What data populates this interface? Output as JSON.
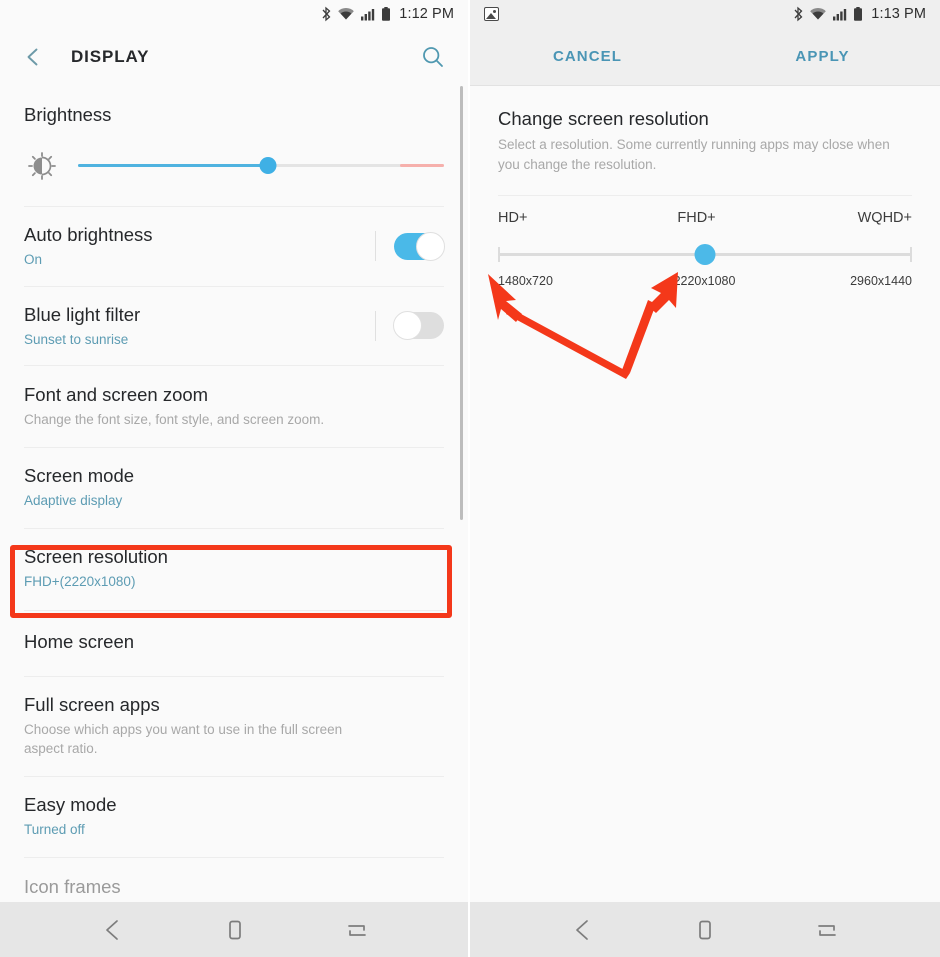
{
  "left_panel": {
    "statusbar": {
      "time": "1:12 PM",
      "icons": [
        "bluetooth-icon",
        "wifi-icon",
        "signal-icon",
        "battery-icon"
      ]
    },
    "appbar": {
      "back_icon": "back-chevron-icon",
      "title": "DISPLAY",
      "search_icon": "search-icon"
    },
    "brightness": {
      "label": "Brightness",
      "icon": "brightness-sun-icon",
      "value_percent": 52,
      "fill_color": "#4fb3e0",
      "thumb_color": "#3fb0e5",
      "warn_color": "#f6b0ac"
    },
    "items": [
      {
        "title": "Auto brightness",
        "sub": "On",
        "sub_style": "teal",
        "control": "toggle",
        "toggle_state": "on"
      },
      {
        "title": "Blue light filter",
        "sub": "Sunset to sunrise",
        "sub_style": "teal",
        "control": "toggle",
        "toggle_state": "off"
      },
      {
        "title": "Font and screen zoom",
        "sub": "Change the font size, font style, and screen zoom.",
        "sub_style": "grey",
        "control": "none"
      },
      {
        "title": "Screen mode",
        "sub": "Adaptive display",
        "sub_style": "teal",
        "control": "none"
      },
      {
        "title": "Screen resolution",
        "sub": "FHD+(2220x1080)",
        "sub_style": "teal",
        "control": "none",
        "highlighted": true
      },
      {
        "title": "Home screen",
        "sub": "",
        "sub_style": "none",
        "control": "none"
      },
      {
        "title": "Full screen apps",
        "sub": "Choose which apps you want to use in the full screen aspect ratio.",
        "sub_style": "grey",
        "control": "none"
      },
      {
        "title": "Easy mode",
        "sub": "Turned off",
        "sub_style": "teal",
        "control": "none"
      },
      {
        "title": "Icon frames",
        "sub": "",
        "sub_style": "none",
        "control": "none"
      }
    ],
    "highlight_color": "#f4381a"
  },
  "right_panel": {
    "statusbar": {
      "time": "1:13 PM",
      "notification_icon": "image-notification-icon",
      "icons": [
        "bluetooth-icon",
        "wifi-icon",
        "signal-icon",
        "battery-icon"
      ]
    },
    "actionbar": {
      "cancel_label": "CANCEL",
      "apply_label": "APPLY",
      "action_color": "#4a95b5"
    },
    "resolution": {
      "title": "Change screen resolution",
      "description": "Select a resolution. Some currently running apps may close when you change the resolution.",
      "options": [
        {
          "name": "HD+",
          "pixels": "1480x720"
        },
        {
          "name": "FHD+",
          "pixels": "2220x1080"
        },
        {
          "name": "WQHD+",
          "pixels": "2960x1440"
        }
      ],
      "selected_index": 1,
      "thumb_color": "#4cb9e8"
    },
    "annotations": {
      "arrow_color": "#f4381a",
      "arrow_count": 2,
      "arrow_targets": [
        "1480x720",
        "2220x1080"
      ]
    }
  },
  "navbar": {
    "back_icon": "nav-back-icon",
    "home_icon": "nav-home-icon",
    "recents_icon": "nav-recents-icon"
  }
}
